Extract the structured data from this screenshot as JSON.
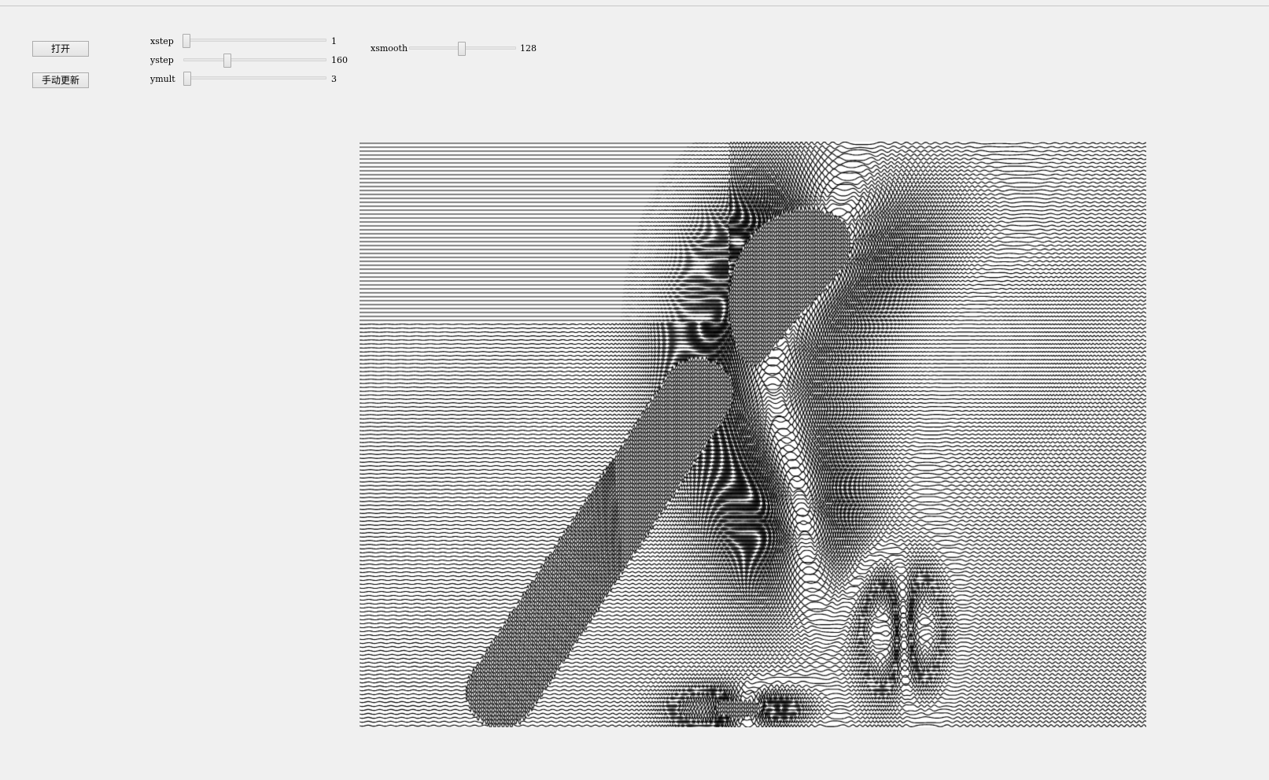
{
  "buttons": {
    "open_label": "打开",
    "update_label": "手动更新"
  },
  "sliders": {
    "xstep": {
      "label": "xstep",
      "value": "1",
      "min": 1,
      "max": 100,
      "current": 1
    },
    "ystep": {
      "label": "ystep",
      "value": "160",
      "min": 1,
      "max": 640,
      "current": 160
    },
    "ymult": {
      "label": "ymult",
      "value": "3",
      "min": 1,
      "max": 100,
      "current": 3
    },
    "xsmooth": {
      "label": "xsmooth",
      "value": "128",
      "min": 1,
      "max": 256,
      "current": 128
    }
  },
  "colors": {
    "background": "#f0f0f0",
    "ink": "#000000",
    "canvas": "#ffffff"
  }
}
